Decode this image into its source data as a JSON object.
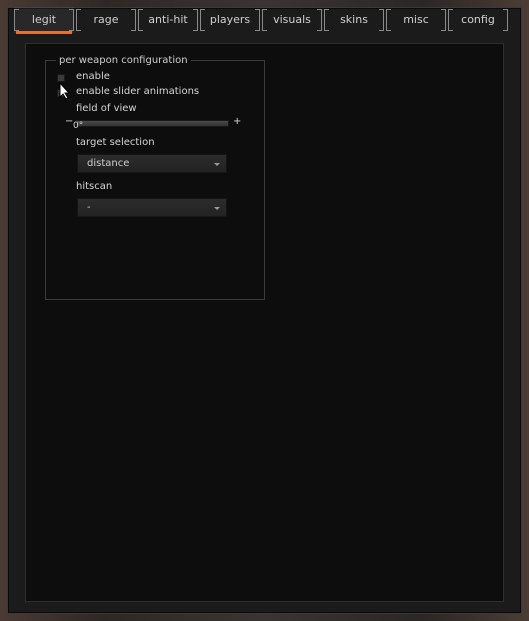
{
  "tabs": [
    {
      "label": "legit",
      "active": true
    },
    {
      "label": "rage",
      "active": false
    },
    {
      "label": "anti-hit",
      "active": false
    },
    {
      "label": "players",
      "active": false
    },
    {
      "label": "visuals",
      "active": false
    },
    {
      "label": "skins",
      "active": false
    },
    {
      "label": "misc",
      "active": false
    },
    {
      "label": "config",
      "active": false
    }
  ],
  "accent_color": "#e2703a",
  "group": {
    "title": "per weapon configuration",
    "enable_label": "enable",
    "enable_checked": false,
    "slider_anim_label": "enable slider animations",
    "slider_anim_checked": false,
    "fov": {
      "label": "field of view",
      "minus": "−",
      "plus": "+",
      "value": "0°",
      "fraction": 0
    },
    "target_selection": {
      "label": "target selection",
      "value": "distance"
    },
    "hitscan": {
      "label": "hitscan",
      "value": "-"
    }
  }
}
